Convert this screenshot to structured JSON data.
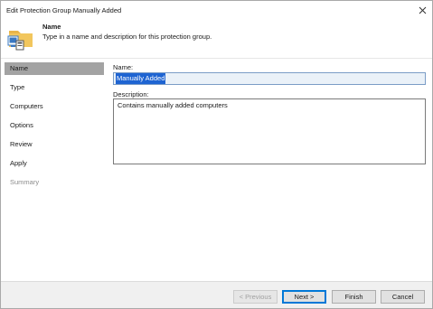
{
  "window": {
    "title": "Edit Protection Group Manually Added"
  },
  "header": {
    "title": "Name",
    "subtitle": "Type in a name and description for this protection group."
  },
  "sidebar": {
    "items": [
      {
        "label": "Name",
        "state": "active"
      },
      {
        "label": "Type",
        "state": "normal"
      },
      {
        "label": "Computers",
        "state": "normal"
      },
      {
        "label": "Options",
        "state": "normal"
      },
      {
        "label": "Review",
        "state": "normal"
      },
      {
        "label": "Apply",
        "state": "normal"
      },
      {
        "label": "Summary",
        "state": "disabled"
      }
    ]
  },
  "form": {
    "name_label": "Name:",
    "name_value": "Manually Added",
    "description_label": "Description:",
    "description_value": "Contains manually added computers"
  },
  "footer": {
    "previous_label": "< Previous",
    "next_label": "Next >",
    "finish_label": "Finish",
    "cancel_label": "Cancel"
  },
  "colors": {
    "active_sidebar": "#a3a3a3",
    "selection": "#1e64d2",
    "primary_border": "#0078d7"
  }
}
